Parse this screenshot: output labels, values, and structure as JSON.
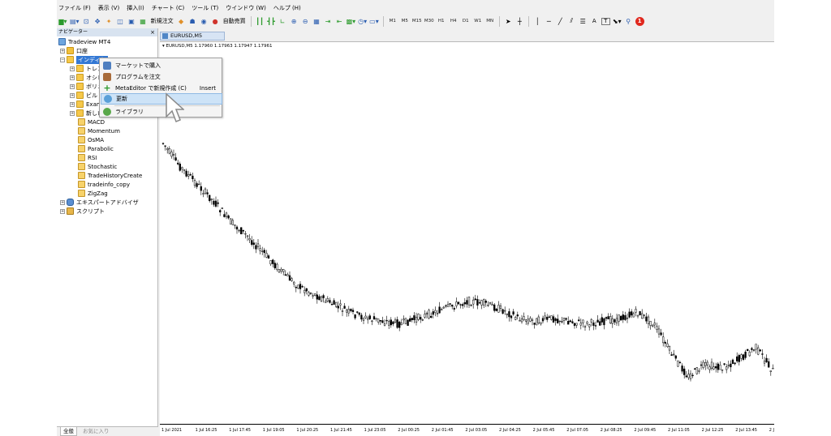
{
  "menu": [
    "ファイル (F)",
    "表示 (V)",
    "挿入(I)",
    "チャート (C)",
    "ツール (T)",
    "ウインドウ (W)",
    "ヘルプ (H)"
  ],
  "toolbar": {
    "new_order": "新規注文",
    "auto_trade": "自動売買",
    "timeframes": [
      "M1",
      "M5",
      "M15",
      "M30",
      "H1",
      "H4",
      "D1",
      "W1",
      "MN"
    ],
    "alert_count": "1",
    "text_tool_a": "A",
    "text_tool_t": "T"
  },
  "navigator": {
    "title": "ナビゲーター",
    "close": "×",
    "root": "Tradeview MT4",
    "account": "口座",
    "indicators": "インディケ",
    "groups": [
      "トレン",
      "オシレ",
      "ボリュ",
      "ビル・",
      "Exam",
      "新しい"
    ],
    "items": [
      "MACD",
      "Momentum",
      "OsMA",
      "Parabolic",
      "RSI",
      "Stochastic",
      "TradeHistoryCreate",
      "tradeinfo_copy",
      "ZigZag"
    ],
    "experts": "エキスパートアドバイザ",
    "scripts": "スクリプト",
    "tabs": [
      "全般",
      "お気に入り"
    ]
  },
  "context_menu": {
    "items": [
      {
        "label": "マーケットで購入",
        "icon": "market-icon",
        "shortcut": ""
      },
      {
        "label": "プログラムを注文",
        "icon": "order-program-icon",
        "shortcut": ""
      },
      {
        "label": "MetaEditor で新規作成 (C)",
        "icon": "plus-icon",
        "shortcut": "Insert"
      },
      {
        "label": "更新",
        "icon": "refresh-icon",
        "shortcut": ""
      },
      {
        "label": "ライブラリ",
        "icon": "library-icon",
        "shortcut": ""
      }
    ],
    "highlighted": "更新"
  },
  "chart": {
    "tab_title": "EURUSD,M5",
    "info": "EURUSD,M5  1.17960 1.17963 1.17947 1.17961",
    "x_labels": [
      "1 Jul 2021",
      "1 Jul 16:25",
      "1 Jul 17:45",
      "1 Jul 19:05",
      "1 Jul 20:25",
      "1 Jul 21:45",
      "1 Jul 23:05",
      "2 Jul 00:25",
      "2 Jul 01:45",
      "2 Jul 03:05",
      "2 Jul 04:25",
      "2 Jul 05:45",
      "2 Jul 07:05",
      "2 Jul 08:25",
      "2 Jul 09:45",
      "2 Jul 11:05",
      "2 Jul 12:25",
      "2 Jul 13:45",
      "2 J"
    ],
    "price_path": [
      0.82,
      0.74,
      0.68,
      0.62,
      0.55,
      0.5,
      0.44,
      0.38,
      0.33,
      0.3,
      0.27,
      0.24,
      0.22,
      0.21,
      0.2,
      0.22,
      0.24,
      0.26,
      0.28,
      0.27,
      0.25,
      0.22,
      0.21,
      0.22,
      0.21,
      0.2,
      0.21,
      0.22,
      0.24,
      0.2,
      0.1,
      0.02,
      0.06,
      0.05,
      0.08,
      0.12,
      0.04
    ]
  }
}
